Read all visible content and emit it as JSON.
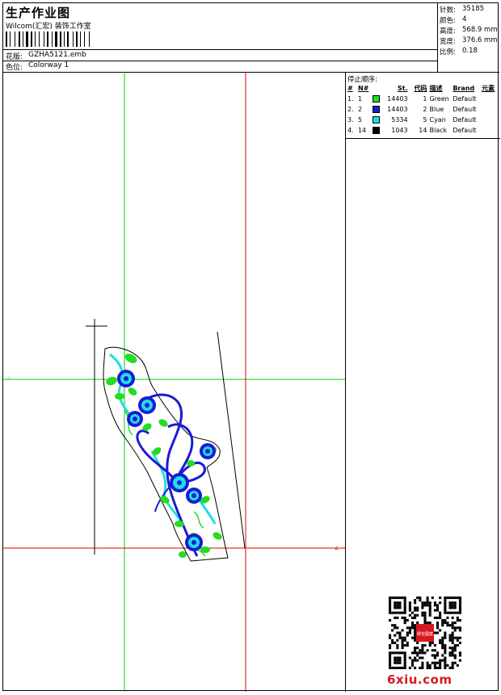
{
  "header": {
    "title": "生产作业图",
    "subtitle": "Wilcom(汇宏) 装饰工作室",
    "design_label": "花版:",
    "design_value": "GZHA5121.emb",
    "colorway_label": "色位:",
    "colorway_value": "Colorway 1"
  },
  "specs": [
    {
      "key": "针数:",
      "value": "35185"
    },
    {
      "key": "颜色:",
      "value": "4"
    },
    {
      "key": "高度:",
      "value": "568.9 mm"
    },
    {
      "key": "宽度:",
      "value": "376.6 mm"
    },
    {
      "key": "比例:",
      "value": "0.18"
    }
  ],
  "stop_sequence": {
    "title": "停止顺序:",
    "headers": [
      "#",
      "N#",
      "",
      "St.",
      "代码",
      "描述",
      "Brand",
      "元素"
    ],
    "rows": [
      {
        "idx": "1.",
        "n": "1",
        "color": "#22dd22",
        "stitches": "14403",
        "code": "1",
        "desc": "Green",
        "brand": "Default"
      },
      {
        "idx": "2.",
        "n": "2",
        "color": "#1a1ad8",
        "stitches": "14403",
        "code": "2",
        "desc": "Blue",
        "brand": "Default"
      },
      {
        "idx": "3.",
        "n": "5",
        "color": "#1ee0e0",
        "stitches": "5334",
        "code": "5",
        "desc": "Cyan",
        "brand": "Default"
      },
      {
        "idx": "4.",
        "n": "14",
        "color": "#000000",
        "stitches": "1043",
        "code": "14",
        "desc": "Black",
        "brand": "Default"
      }
    ]
  },
  "watermark": {
    "brand_text": "6xiu.com",
    "seal_text": "绣花图案"
  },
  "colors": {
    "guide_green": "#00d000",
    "guide_red": "#e00000",
    "thread_green": "#22dd22",
    "thread_blue": "#1a1ad8",
    "thread_cyan": "#1ee0e0",
    "brand_red": "#d71920"
  }
}
